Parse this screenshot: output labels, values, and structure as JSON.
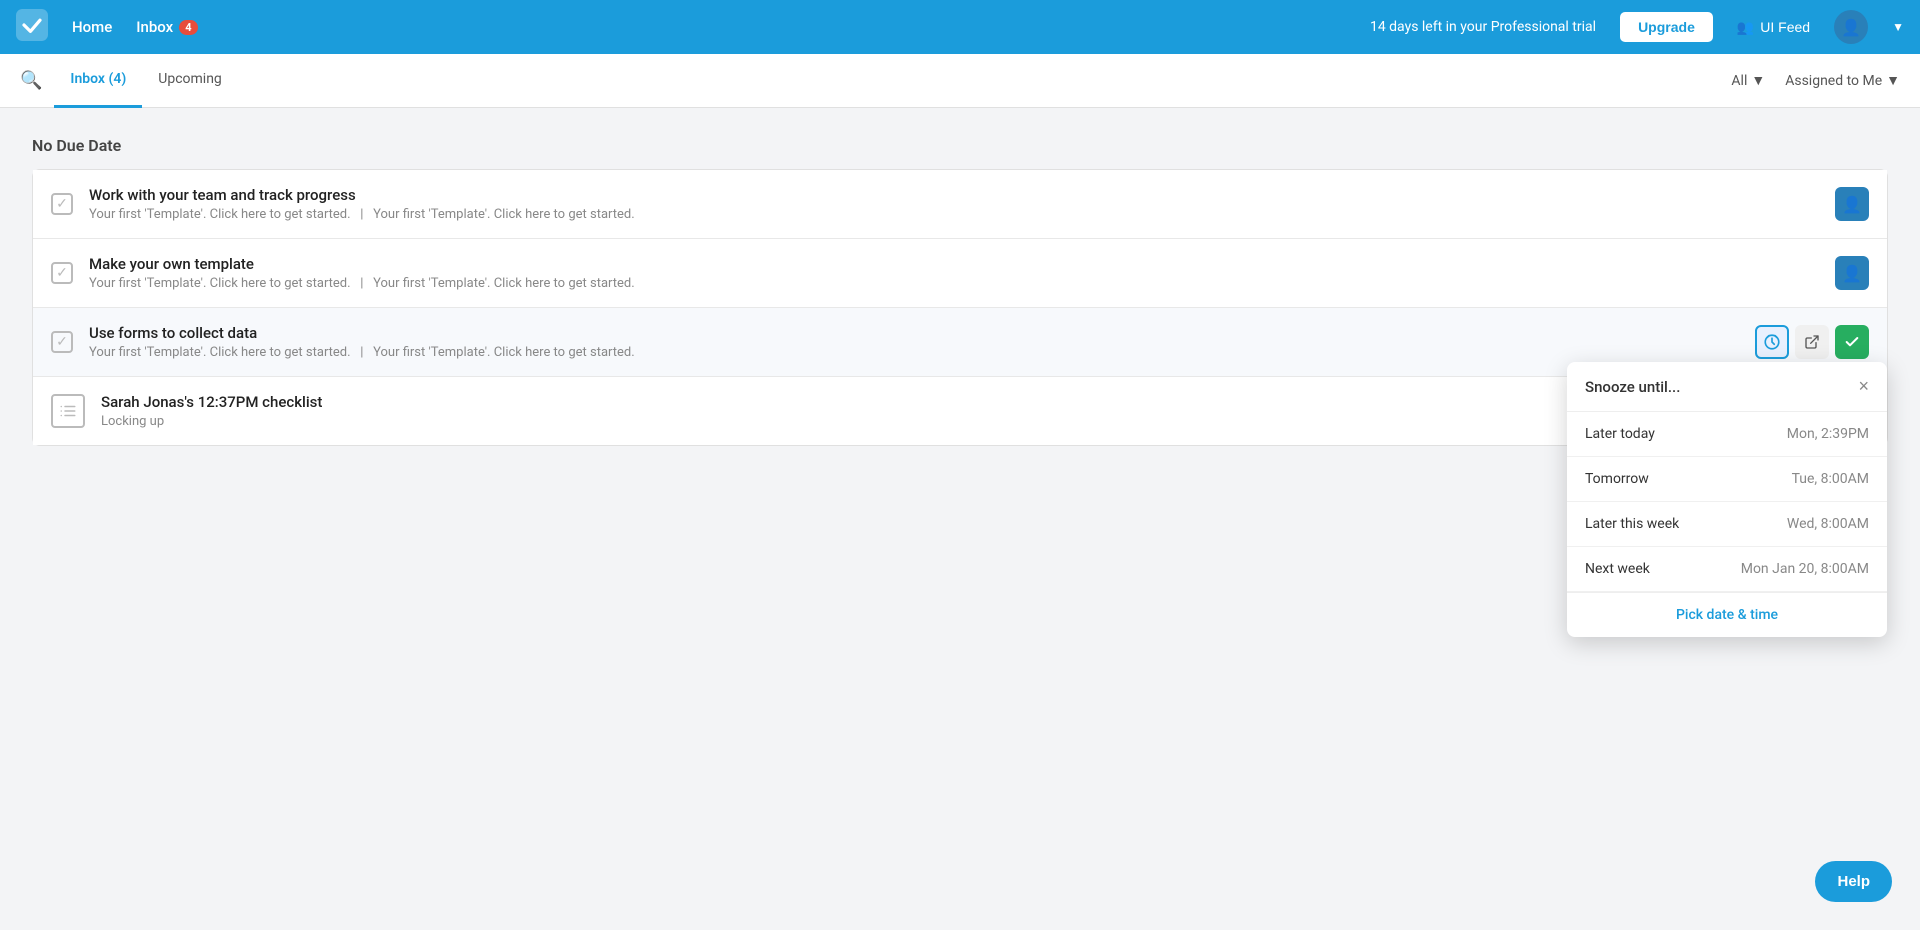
{
  "topnav": {
    "home_label": "Home",
    "inbox_label": "Inbox",
    "inbox_badge": "4",
    "trial_text": "14 days left in your Professional trial",
    "upgrade_label": "Upgrade",
    "ui_feed_label": "UI Feed",
    "avatar_icon": "👤"
  },
  "subnav": {
    "inbox_tab_label": "Inbox (4)",
    "upcoming_tab_label": "Upcoming",
    "filter_all_label": "All",
    "filter_assigned_label": "Assigned to Me"
  },
  "main": {
    "section_heading": "No Due Date",
    "tasks": [
      {
        "id": 1,
        "title": "Work with your team and track progress",
        "subtitle": "Your first 'Template'. Click here to get started.   |   Your first 'Template'. Click here to get started.",
        "type": "checkbox",
        "has_avatar": true
      },
      {
        "id": 2,
        "title": "Make your own template",
        "subtitle": "Your first 'Template'. Click here to get started.   |   Your first 'Template'. Click here to get started.",
        "type": "checkbox",
        "has_avatar": true
      },
      {
        "id": 3,
        "title": "Use forms to collect data",
        "subtitle": "Your first 'Template'. Click here to get started.   |   Your first 'Template'. Click here to get started.",
        "type": "checkbox",
        "has_avatar": false,
        "show_actions": true
      },
      {
        "id": 4,
        "title": "Sarah Jonas's 12:37PM checklist",
        "subtitle": "Locking up",
        "type": "list",
        "has_avatar": false
      }
    ]
  },
  "snooze": {
    "title": "Snooze until...",
    "close_label": "×",
    "options": [
      {
        "label": "Later today",
        "time": "Mon, 2:39PM"
      },
      {
        "label": "Tomorrow",
        "time": "Tue, 8:00AM"
      },
      {
        "label": "Later this week",
        "time": "Wed, 8:00AM"
      },
      {
        "label": "Next week",
        "time": "Mon Jan 20, 8:00AM"
      }
    ],
    "pick_label": "Pick date & time"
  },
  "help_btn_label": "Help"
}
